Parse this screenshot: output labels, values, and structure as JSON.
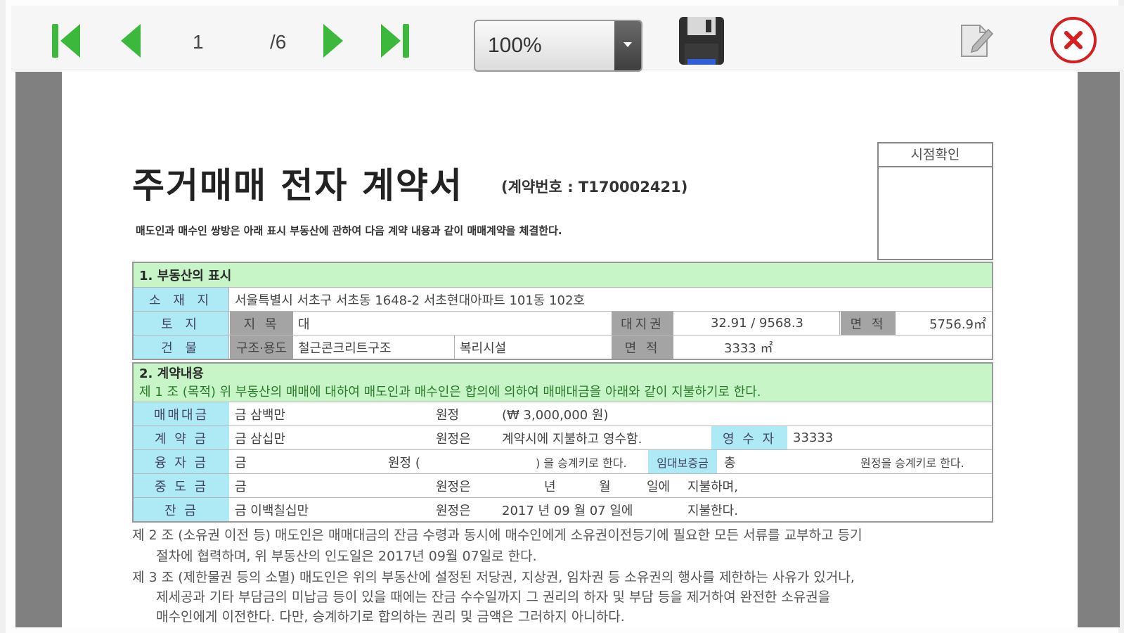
{
  "toolbar": {
    "page_current": "1",
    "page_total": "/6",
    "zoom": "100%",
    "colors": {
      "nav_green": "#3cb83c",
      "close_red": "#d42020"
    }
  },
  "doc": {
    "title": "주거매매 전자 계약서",
    "contract_no": "(계약번호 : T170002421)",
    "intro": "매도인과 매수인 쌍방은 아래 표시 부동산에 관하여 다음 계약 내용과 같이 매매계약을 체결한다.",
    "stamp_label": "시점확인",
    "section1": {
      "heading": "1. 부동산의 표시",
      "location_label": "소 재 지",
      "location_value": "서울특별시 서초구 서초동 1648-2  서초현대아파트 101동 102호",
      "land_label": "토    지",
      "land_category_label": "지    목",
      "land_category_value": "대",
      "land_right_label": "대지권",
      "land_right_value": "32.91 / 9568.3",
      "land_area_label": "면 적",
      "land_area_value": "5756.9㎡",
      "building_label": "건    물",
      "structure_label": "구조·용도",
      "structure_value": "철근콘크리트구조",
      "use_value": "복리시설",
      "building_area_label": "면    적",
      "building_area_value": "3333  ㎡"
    },
    "section2": {
      "heading": "2. 계약내용",
      "clause1": "제 1 조 (목적) 위 부동산의 매매에 대하여 매도인과 매수인은 합의에 의하여 매매대금을 아래와 같이 지불하기로 한다.",
      "rows": {
        "price_label": "매매대금",
        "price_value": "금 삼백만",
        "price_unit": "원정",
        "price_won": "(₩ 3,000,000 원)",
        "deposit_label": "계 약 금",
        "deposit_value": "금 삼십만",
        "deposit_unit": "원정은",
        "deposit_note": "계약시에 지불하고 영수함.",
        "receiver_label": "영 수 자",
        "receiver_value": "33333",
        "loan_label": "융 자 금",
        "loan_value": "금",
        "loan_unit": "원정 (",
        "loan_note": ") 을 승계키로 한다.",
        "lease_label": "임대보증금",
        "lease_value": "총",
        "lease_note": "원정을 승계키로 한다.",
        "middle_label": "중 도 금",
        "middle_value": "금",
        "middle_unit": "원정은",
        "middle_year": "년",
        "middle_month": "월",
        "middle_day": "일에",
        "middle_note": "지불하며,",
        "balance_label": "잔    금",
        "balance_value": "금 이백칠십만",
        "balance_unit": "원정은",
        "balance_date": "2017 년    09 월    07 일에",
        "balance_note": "지불한다."
      }
    },
    "clause2_line1": "제 2 조 (소유권 이전 등)   매도인은 매매대금의 잔금 수령과 동시에 매수인에게 소유권이전등기에 필요한 모든 서류를 교부하고 등기",
    "clause2_line2": "절차에 협력하며, 위 부동산의 인도일은 2017년 09월 07일로 한다.",
    "clause3_line1": "제 3 조 (제한물권 등의 소멸)   매도인은 위의 부동산에 설정된 저당권, 지상권, 임차권 등 소유권의 행사를 제한하는 사유가 있거나,",
    "clause3_line2": "제세공과 기타 부담금의 미납금 등이 있을 때에는 잔금 수수일까지 그 권리의 하자 및 부담 등을 제거하여 완전한 소유권을",
    "clause3_line3": "매수인에게 이전한다. 다만, 승계하기로 합의하는 권리 및 금액은 그러하지 아니하다."
  }
}
